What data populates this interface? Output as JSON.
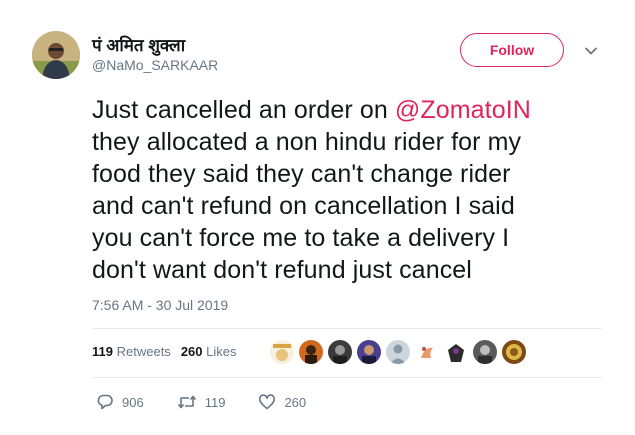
{
  "user": {
    "display_name": "पं अमित शुक्ला",
    "handle": "@NaMo_SARKAAR"
  },
  "follow_label": "Follow",
  "tweet": {
    "lines": [
      "Just cancelled an order on ",
      "they allocated a non hindu rider for my",
      "food they said they can't change rider",
      "and can't refund on cancellation I said",
      "you can't force me to take a delivery I",
      "don't want don't refund just cancel"
    ],
    "mention": "@ZomatoIN"
  },
  "timestamp": "7:56 AM - 30 Jul 2019",
  "stats": {
    "retweets_count": "119",
    "retweets_label": "Retweets",
    "likes_count": "260",
    "likes_label": "Likes"
  },
  "actions": {
    "replies": "906",
    "retweets": "119",
    "likes": "260"
  },
  "icons": [
    "chevron-down-icon",
    "reply-icon",
    "retweet-icon",
    "heart-icon"
  ],
  "colors": {
    "accent": "#e0245e",
    "secondary_text": "#657786",
    "primary_text": "#14171a",
    "divider": "#e6ecf0"
  }
}
